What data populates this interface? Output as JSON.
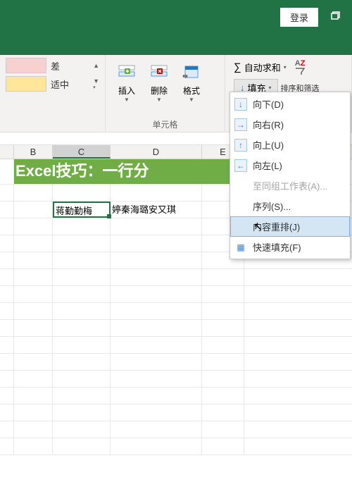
{
  "titlebar": {
    "login": "登录"
  },
  "ribbon": {
    "styles": {
      "bad": {
        "label": "差",
        "color": "#f8d0d0"
      },
      "neutral": {
        "label": "适中",
        "color": "#ffe699"
      }
    },
    "cells": {
      "insert": "插入",
      "delete": "删除",
      "format": "格式",
      "group": "单元格"
    },
    "editing": {
      "autosum": "自动求和",
      "fill": "填充",
      "sort_truncated": "排序和筛选"
    }
  },
  "columns": {
    "B": "B",
    "C": "C",
    "D": "D",
    "E": "E"
  },
  "col_widths": {
    "B": 55,
    "C": 82,
    "D": 130,
    "E": 60
  },
  "sheet": {
    "banner": "Excel技巧：一行分",
    "c3": "蒋勤勤梅",
    "d3": "婷秦海璐安又琪"
  },
  "menu": {
    "down": "向下(D)",
    "right": "向右(R)",
    "up": "向上(U)",
    "left": "向左(L)",
    "across": "至同组工作表(A)...",
    "series": "序列(S)...",
    "justify": "内容重排(J)",
    "flash": "快速填充(F)"
  }
}
